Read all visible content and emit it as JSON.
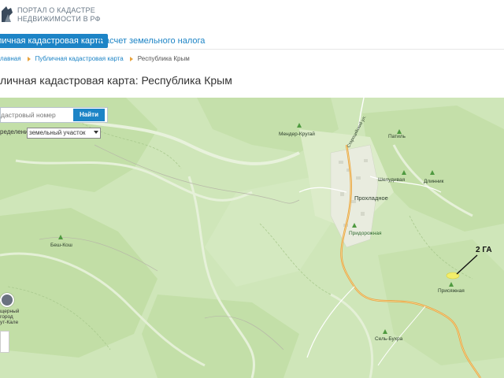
{
  "header": {
    "logo_line1": "ПОРТАЛ О КАДАСТРЕ",
    "logo_line2": "НЕДВИЖИМОСТИ В РФ"
  },
  "nav": {
    "active_tab": "личная кадастровая карта",
    "tab2": "Расчет земельного налога"
  },
  "breadcrumb": {
    "home": "лавная",
    "section": "Публичная кадастровая карта",
    "current": "Республика Крым"
  },
  "title": "личная кадастровая карта: Республика Крым",
  "search": {
    "placeholder": "дастровый номер",
    "button": "Найти"
  },
  "filter": {
    "label": "ределение",
    "selected": "земельный участок"
  },
  "places": {
    "mender": "Мендер-Кругай",
    "patil": "Патиль",
    "sholudivaya": "Шелудивая",
    "dlinnik": "Длинник",
    "prokhladnoe": "Прохладное",
    "pridorozhnaya": "Придорожная",
    "besh_kosh": "Беш-Кош",
    "prisyazhnaya": "Присяжная",
    "selbukhra": "Сель-Бухра",
    "road": "Староцийский ул."
  },
  "poi": {
    "line1": "щерный",
    "line2": "город",
    "line3": "ут-Кале"
  },
  "annotation": "2 ГА",
  "colors": {
    "brand_blue": "#1d84c6",
    "map_green": "#cfe6b9",
    "map_dark_green": "#b5d89a",
    "road_orange": "#e8a33d",
    "plot_yellow": "#f2ee6a"
  }
}
